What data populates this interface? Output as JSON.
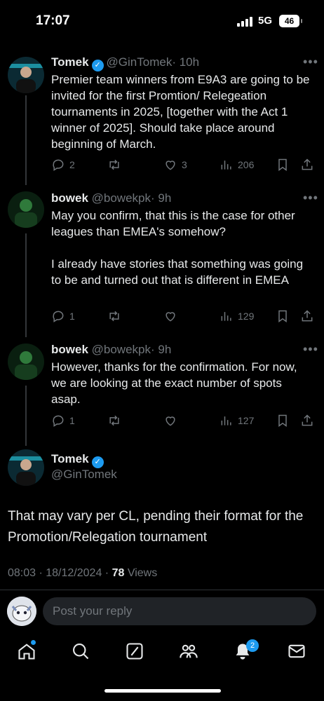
{
  "status": {
    "time": "17:07",
    "network": "5G",
    "battery": "46"
  },
  "tweets": [
    {
      "name": "Tomek",
      "handle": "@GinTomek",
      "time": "· 10h",
      "text": "Premier team winners from E9A3 are going to be invited for the first Promtion/ Relegeation tournaments in 2025, [together with the Act 1 winner of 2025]. Should take place around beginning of March.",
      "replies": "2",
      "retweets": "",
      "likes": "3",
      "views": "206"
    },
    {
      "name": "bowek",
      "handle": "@bowekpk",
      "time": "· 9h",
      "text": "May you confirm, that this is the case for other leagues than EMEA's somehow?\n\nI already have stories that something was going to be and turned out that is different in EMEA",
      "replies": "1",
      "retweets": "",
      "likes": "",
      "views": "129"
    },
    {
      "name": "bowek",
      "handle": "@bowekpk",
      "time": "· 9h",
      "text": "However, thanks for the confirmation. For now, we are looking at the exact number of spots asap.",
      "replies": "1",
      "retweets": "",
      "likes": "",
      "views": "127"
    }
  ],
  "main_tweet": {
    "name": "Tomek",
    "handle": "@GinTomek",
    "text": "That may vary per CL, pending their format for the Promotion/Relegation tournament",
    "timestamp": "08:03 · 18/12/2024 · ",
    "views_count": "78",
    "views_label": "Views"
  },
  "reply": {
    "placeholder": "Post your reply"
  },
  "tabbar": {
    "notifications_badge": "2"
  },
  "colors": {
    "accent": "#1d9bf0",
    "background": "#000000",
    "muted": "#71767b"
  },
  "icons": [
    "verified-icon",
    "more-icon",
    "reply-icon",
    "retweet-icon",
    "like-icon",
    "views-icon",
    "bookmark-icon",
    "share-icon",
    "home-icon",
    "search-icon",
    "compose-icon",
    "communities-icon",
    "bell-icon",
    "mail-icon"
  ]
}
